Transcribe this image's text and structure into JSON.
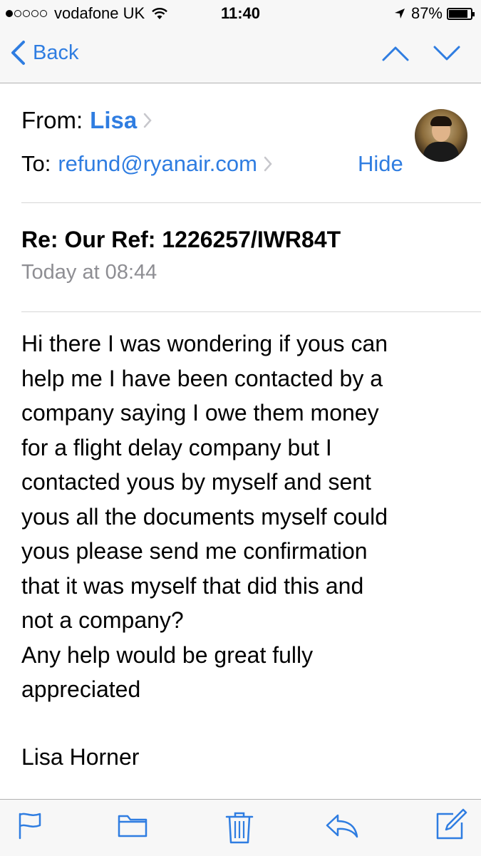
{
  "status_bar": {
    "carrier": "vodafone UK",
    "time": "11:40",
    "battery": "87%",
    "battery_level": 0.87,
    "signal_bars_filled": 1,
    "signal_bars_total": 5
  },
  "nav": {
    "back_label": "Back",
    "icons": [
      "chevron-left-icon",
      "chevron-up-icon",
      "chevron-down-icon"
    ]
  },
  "header": {
    "from_label": "From:",
    "from_name": "Lisa",
    "to_label": "To:",
    "to_address": "refund@ryanair.com",
    "hide_label": "Hide"
  },
  "message": {
    "subject": "Re: Our Ref: 1226257/IWR84T",
    "date": "Today at 08:44",
    "body_lines": [
      "Hi there I was wondering if yous can",
      "help me I have been contacted by a",
      "company saying I owe them money",
      "for a flight delay company but I",
      "contacted yous by myself and sent",
      "yous all the documents myself could",
      "yous please send me confirmation",
      "that it was myself that did this and",
      "not a company?",
      "Any help would be great fully",
      "appreciated"
    ],
    "signature": "Lisa Horner"
  },
  "toolbar": {
    "icons": [
      "flag-icon",
      "folder-icon",
      "trash-icon",
      "reply-icon",
      "compose-icon"
    ]
  },
  "colors": {
    "accent": "#2f7de1",
    "secondary_text": "#8e8e93",
    "bar_background": "#f7f7f7"
  }
}
